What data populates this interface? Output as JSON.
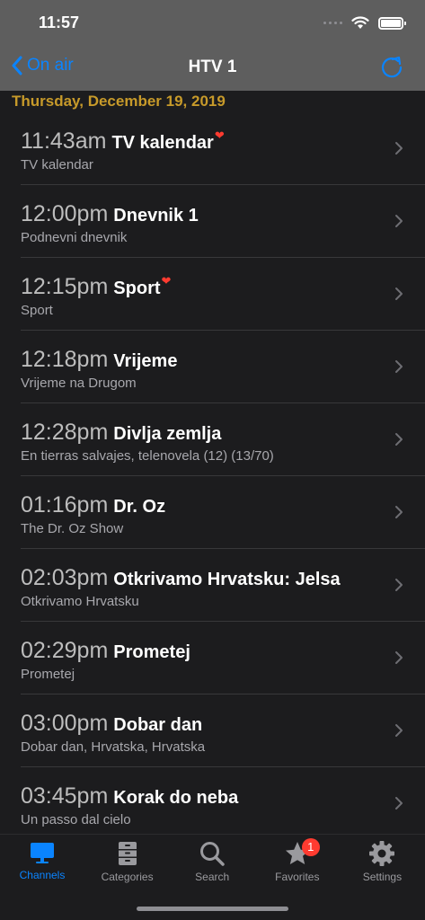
{
  "status": {
    "time": "11:57"
  },
  "nav": {
    "back_label": "On air",
    "title": "HTV 1"
  },
  "section": {
    "date": "Thursday, December 19, 2019"
  },
  "programs": [
    {
      "time": "11:43am",
      "title": "TV kalendar",
      "subtitle": "TV kalendar",
      "favorite": true
    },
    {
      "time": "12:00pm",
      "title": "Dnevnik 1",
      "subtitle": "Podnevni dnevnik",
      "favorite": false
    },
    {
      "time": "12:15pm",
      "title": "Sport",
      "subtitle": "Sport",
      "favorite": true
    },
    {
      "time": "12:18pm",
      "title": "Vrijeme",
      "subtitle": "Vrijeme na Drugom",
      "favorite": false
    },
    {
      "time": "12:28pm",
      "title": "Divlja zemlja",
      "subtitle": "En tierras salvajes, telenovela (12) (13/70)",
      "favorite": false
    },
    {
      "time": "01:16pm",
      "title": "Dr. Oz",
      "subtitle": "The Dr. Oz Show",
      "favorite": false
    },
    {
      "time": "02:03pm",
      "title": "Otkrivamo Hrvatsku: Jelsa",
      "subtitle": "Otkrivamo Hrvatsku",
      "favorite": false
    },
    {
      "time": "02:29pm",
      "title": "Prometej",
      "subtitle": "Prometej",
      "favorite": false
    },
    {
      "time": "03:00pm",
      "title": "Dobar dan",
      "subtitle": "Dobar dan, Hrvatska, Hrvatska",
      "favorite": false
    },
    {
      "time": "03:45pm",
      "title": "Korak do neba",
      "subtitle": "Un passo dal cielo",
      "favorite": false
    }
  ],
  "tabs": [
    {
      "label": "Channels",
      "icon": "tv-icon",
      "active": true
    },
    {
      "label": "Categories",
      "icon": "cabinet-icon",
      "active": false
    },
    {
      "label": "Search",
      "icon": "search-icon",
      "active": false
    },
    {
      "label": "Favorites",
      "icon": "star-icon",
      "active": false,
      "badge": "1"
    },
    {
      "label": "Settings",
      "icon": "gear-icon",
      "active": false
    }
  ],
  "colors": {
    "accent": "#0a84ff",
    "date": "#c79a2a",
    "badge": "#ff3b30"
  }
}
